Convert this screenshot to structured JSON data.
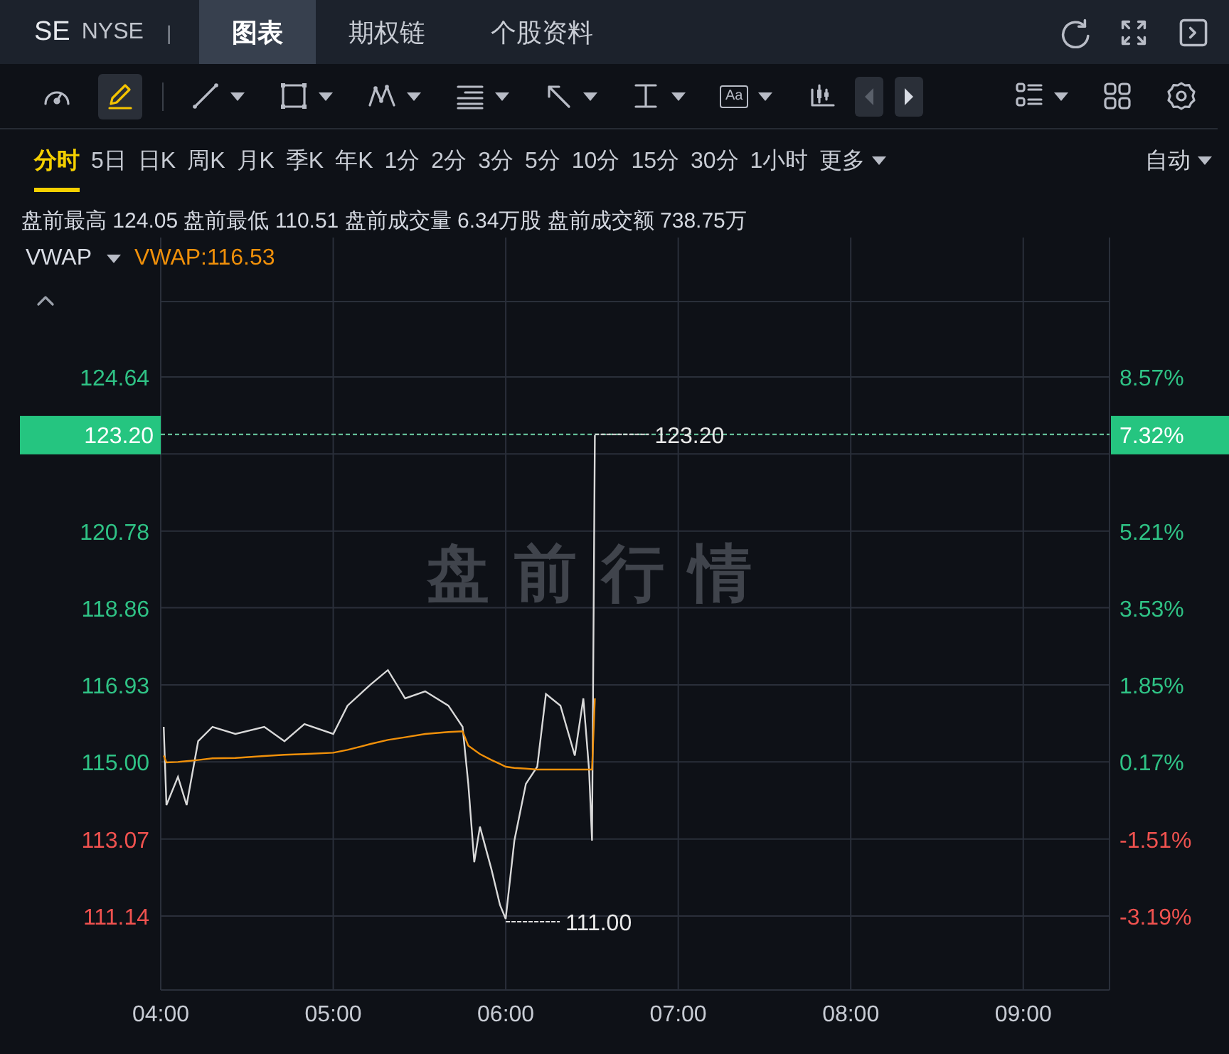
{
  "header": {
    "symbol": "SE",
    "exchange": "NYSE",
    "separator": "|",
    "tabs": [
      {
        "label": "图表",
        "selected": true
      },
      {
        "label": "期权链",
        "selected": false
      },
      {
        "label": "个股资料",
        "selected": false
      }
    ],
    "actions": [
      {
        "kind": "refresh"
      },
      {
        "kind": "fullscreen"
      },
      {
        "kind": "panel"
      }
    ]
  },
  "toolbar": [
    {
      "kind": "gauge",
      "selected": false,
      "dropdown": false
    },
    {
      "kind": "pencil",
      "selected": true,
      "dropdown": false
    },
    {
      "kind": "separator"
    },
    {
      "kind": "line",
      "selected": false,
      "dropdown": true
    },
    {
      "kind": "rect",
      "selected": false,
      "dropdown": true
    },
    {
      "kind": "pattern",
      "selected": false,
      "dropdown": true
    },
    {
      "kind": "fib",
      "selected": false,
      "dropdown": true
    },
    {
      "kind": "arrow",
      "selected": false,
      "dropdown": true
    },
    {
      "kind": "measure",
      "selected": false,
      "dropdown": true
    },
    {
      "kind": "text",
      "glyph": "Aa",
      "selected": false,
      "dropdown": true
    },
    {
      "kind": "candles",
      "selected": false,
      "dropdown": false
    },
    {
      "kind": "prev",
      "disabled": true
    },
    {
      "kind": "next",
      "disabled": false
    },
    {
      "kind": "spacer"
    },
    {
      "kind": "layout",
      "selected": false,
      "dropdown": true
    },
    {
      "kind": "grid",
      "selected": false,
      "dropdown": false
    },
    {
      "kind": "settings",
      "selected": false,
      "dropdown": false
    }
  ],
  "intervals": [
    {
      "label": "分时",
      "selected": true,
      "dropdown": false
    },
    {
      "label": "5日",
      "selected": false,
      "dropdown": false
    },
    {
      "label": "日K",
      "selected": false,
      "dropdown": false
    },
    {
      "label": "周K",
      "selected": false,
      "dropdown": false
    },
    {
      "label": "月K",
      "selected": false,
      "dropdown": false
    },
    {
      "label": "季K",
      "selected": false,
      "dropdown": false
    },
    {
      "label": "年K",
      "selected": false,
      "dropdown": false
    },
    {
      "label": "1分",
      "selected": false,
      "dropdown": false
    },
    {
      "label": "2分",
      "selected": false,
      "dropdown": false
    },
    {
      "label": "3分",
      "selected": false,
      "dropdown": false
    },
    {
      "label": "5分",
      "selected": false,
      "dropdown": false
    },
    {
      "label": "10分",
      "selected": false,
      "dropdown": false
    },
    {
      "label": "15分",
      "selected": false,
      "dropdown": false
    },
    {
      "label": "30分",
      "selected": false,
      "dropdown": false
    },
    {
      "label": "1小时",
      "selected": false,
      "dropdown": false
    },
    {
      "label": "更多",
      "selected": false,
      "dropdown": true
    }
  ],
  "scale_mode": {
    "label": "自动"
  },
  "stats": "盘前最高 124.05 盘前最低 110.51 盘前成交量 6.34万股 盘前成交额 738.75万",
  "indicator": {
    "name": "VWAP",
    "value": "VWAP:116.53"
  },
  "chart": {
    "watermark": "盘前行情",
    "axis_left_colors": [
      {
        "color": "#2fc285"
      },
      {
        "color": "#2fc285"
      },
      {
        "color": "#2fc285"
      },
      {
        "color": "#2fc285"
      },
      {
        "color": "#2fc285"
      },
      {
        "color": "#f0524f"
      },
      {
        "color": "#f0524f"
      }
    ],
    "axis_right": [
      {
        "label": "8.57%",
        "color": "#2fc285"
      },
      {
        "label": "5.21%",
        "color": "#2fc285"
      },
      {
        "label": "3.53%",
        "color": "#2fc285"
      },
      {
        "label": "1.85%",
        "color": "#2fc285"
      },
      {
        "label": "0.17%",
        "color": "#2fc285"
      },
      {
        "label": "-1.51%",
        "color": "#f0524f"
      },
      {
        "label": "-3.19%",
        "color": "#f0524f"
      }
    ],
    "last_price": {
      "price_label": "123.20",
      "pct_label": "7.32%"
    },
    "chart_data": {
      "type": "line",
      "xlim": [
        4,
        9.5
      ],
      "ylim": [
        109.29,
        128.13
      ],
      "xticks": [
        {
          "value": 4,
          "label": "04:00"
        },
        {
          "value": 5,
          "label": "05:00"
        },
        {
          "value": 6,
          "label": "06:00"
        },
        {
          "value": 7,
          "label": "07:00"
        },
        {
          "value": 8,
          "label": "08:00"
        },
        {
          "value": 9,
          "label": "09:00"
        }
      ],
      "yticks": [
        {
          "value": 124.64,
          "label": "124.64"
        },
        {
          "value": 120.78,
          "label": "120.78"
        },
        {
          "value": 118.86,
          "label": "118.86"
        },
        {
          "value": 116.93,
          "label": "116.93"
        },
        {
          "value": 115.0,
          "label": "115.00"
        },
        {
          "value": 113.07,
          "label": "113.07"
        },
        {
          "value": 111.14,
          "label": "111.14"
        }
      ],
      "x": [
        4.017,
        4.033,
        4.1,
        4.15,
        4.217,
        4.3,
        4.433,
        4.6,
        4.717,
        4.833,
        5,
        5.083,
        5.217,
        5.317,
        5.417,
        5.533,
        5.667,
        5.75,
        5.783,
        5.817,
        5.85,
        5.917,
        5.967,
        6,
        6.05,
        6.117,
        6.183,
        6.233,
        6.317,
        6.4,
        6.45,
        6.483,
        6.5,
        6.517
      ],
      "grid": true,
      "series": [
        {
          "color": "#d9d9d9",
          "values": [
            115.88,
            113.92,
            114.63,
            113.92,
            115.52,
            115.88,
            115.7,
            115.88,
            115.52,
            115.95,
            115.7,
            116.41,
            116.94,
            117.3,
            116.59,
            116.77,
            116.41,
            115.88,
            114.45,
            112.49,
            113.38,
            112.31,
            111.42,
            111.07,
            113.03,
            114.45,
            114.88,
            116.7,
            116.41,
            115.16,
            116.59,
            114.81,
            113.03,
            123.18
          ]
        },
        {
          "color": "#f0900a",
          "values": [
            115.16,
            114.99,
            115.0,
            115.02,
            115.05,
            115.09,
            115.1,
            115.15,
            115.18,
            115.2,
            115.23,
            115.3,
            115.45,
            115.55,
            115.62,
            115.7,
            115.75,
            115.77,
            115.41,
            115.3,
            115.2,
            115.05,
            114.95,
            114.88,
            114.85,
            114.83,
            114.81,
            114.81,
            114.81,
            114.81,
            114.81,
            114.81,
            114.81,
            116.59
          ]
        }
      ],
      "ref_lines": [
        {
          "axis": "y",
          "value": 123.2
        }
      ],
      "annotations": [
        {
          "text": "123.20",
          "x": 6.517,
          "y": 123.2
        },
        {
          "text": "111.00",
          "x": 6.0,
          "y": 111.0
        }
      ]
    }
  }
}
